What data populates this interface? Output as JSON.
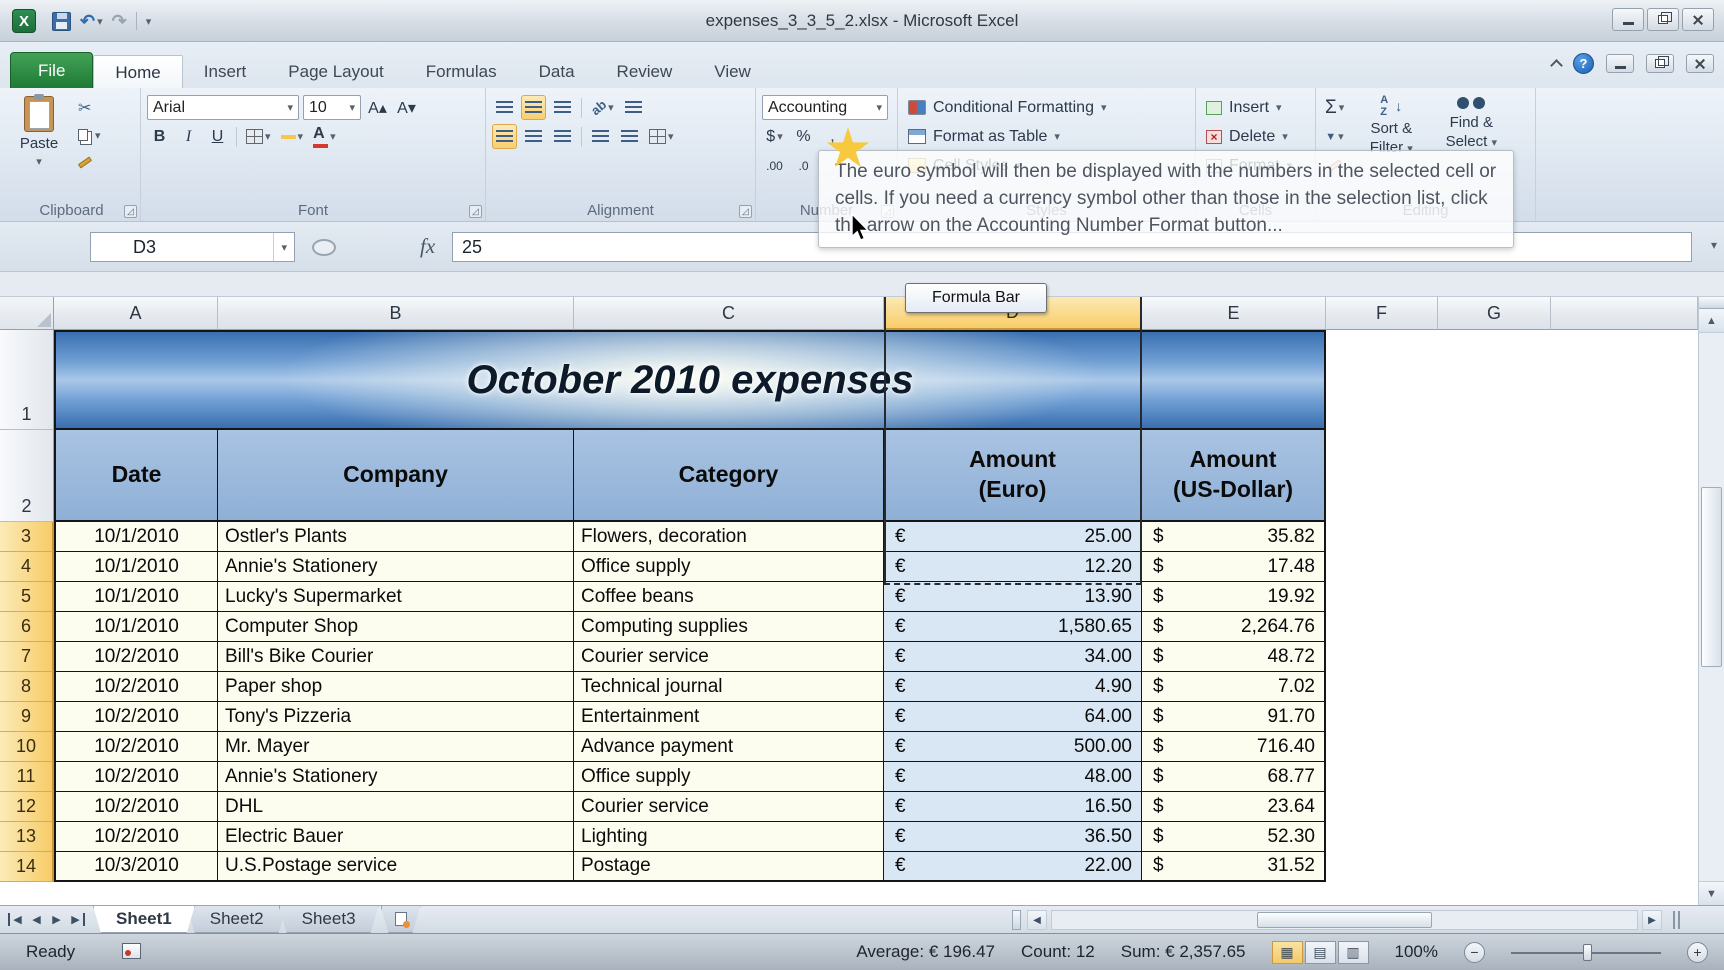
{
  "title_bar": {
    "title": "expenses_3_3_5_2.xlsx - Microsoft Excel"
  },
  "icons": {
    "dropdown": "▾",
    "undo": "↶",
    "redo": "↷",
    "scissors": "✂",
    "sigma": "Σ",
    "dollar": "$",
    "percent": "%",
    "comma": ",",
    "bold": "B",
    "italic": "I",
    "underline": "U",
    "grow_font": "A▴",
    "shrink_font": "A▾",
    "font_color_letter": "A",
    "increase_decimal": ".00",
    "decrease_decimal": ".0",
    "help": "?",
    "up_arrow": "▲",
    "down_arrow": "▼",
    "left_arrow": "◀",
    "right_arrow": "▶",
    "sort_a": "A",
    "sort_z": "Z",
    "small_down": "↓",
    "dialog_launcher": "◿",
    "view_normal": "▦",
    "view_layout": "▤",
    "view_break": "▥",
    "minus": "−",
    "plus": "+",
    "chevron_down": "▾"
  },
  "ribbon": {
    "tabs": [
      "File",
      "Home",
      "Insert",
      "Page Layout",
      "Formulas",
      "Data",
      "Review",
      "View"
    ],
    "active_tab": "Home",
    "clipboard": {
      "paste": "Paste",
      "label": "Clipboard"
    },
    "font": {
      "name": "Arial",
      "size": "10",
      "label": "Font"
    },
    "alignment": {
      "label": "Alignment"
    },
    "number": {
      "format": "Accounting",
      "label": "Number"
    },
    "styles": {
      "conditional_formatting": "Conditional Formatting",
      "format_as_table": "Format as Table",
      "cell_styles": "Cell Styles",
      "label": "Styles"
    },
    "cells": {
      "insert": "Insert",
      "delete": "Delete",
      "format": "Format",
      "label": "Cells"
    },
    "editing": {
      "sort_line1": "Sort &",
      "sort_line2": "Filter",
      "find_line1": "Find &",
      "find_line2": "Select",
      "label": "Editing"
    }
  },
  "tooltip": {
    "text": "The euro symbol will then be displayed with the numbers in the selected cell or cells. If you need a currency symbol other than those in the selection list, click the arrow on the Accounting Number Format button..."
  },
  "formula_bar": {
    "cell_ref": "D3",
    "fx": "fx",
    "value": "25",
    "tooltip": "Formula Bar"
  },
  "colors": {
    "table_header_fill": "#95b3d7",
    "selection_fill": "#d9e7f5",
    "selected_header_fill": "#f8cd69",
    "file_tab_green": "#1e7a35",
    "title_fill_blue": "#3f77b5"
  },
  "sheet": {
    "columns": [
      "A",
      "B",
      "C",
      "D",
      "E",
      "F",
      "G"
    ],
    "selected_column": "D",
    "title": "October 2010 expenses",
    "headers": [
      "Date",
      "Company",
      "Category",
      "Amount\n(Euro)",
      "Amount\n(US-Dollar)"
    ],
    "currency": {
      "eur": "€",
      "usd": "$"
    },
    "rows": [
      {
        "n": 3,
        "date": "10/1/2010",
        "company": "Ostler's Plants",
        "category": "Flowers, decoration",
        "eur": "25.00",
        "usd": "35.82"
      },
      {
        "n": 4,
        "date": "10/1/2010",
        "company": "Annie's Stationery",
        "category": "Office supply",
        "eur": "12.20",
        "usd": "17.48"
      },
      {
        "n": 5,
        "date": "10/1/2010",
        "company": "Lucky's Supermarket",
        "category": "Coffee beans",
        "eur": "13.90",
        "usd": "19.92"
      },
      {
        "n": 6,
        "date": "10/1/2010",
        "company": "Computer Shop",
        "category": "Computing supplies",
        "eur": "1,580.65",
        "usd": "2,264.76"
      },
      {
        "n": 7,
        "date": "10/2/2010",
        "company": "Bill's Bike Courier",
        "category": "Courier service",
        "eur": "34.00",
        "usd": "48.72"
      },
      {
        "n": 8,
        "date": "10/2/2010",
        "company": "Paper shop",
        "category": "Technical journal",
        "eur": "4.90",
        "usd": "7.02"
      },
      {
        "n": 9,
        "date": "10/2/2010",
        "company": "Tony's Pizzeria",
        "category": "Entertainment",
        "eur": "64.00",
        "usd": "91.70"
      },
      {
        "n": 10,
        "date": "10/2/2010",
        "company": "Mr. Mayer",
        "category": "Advance payment",
        "eur": "500.00",
        "usd": "716.40"
      },
      {
        "n": 11,
        "date": "10/2/2010",
        "company": "Annie's Stationery",
        "category": "Office supply",
        "eur": "48.00",
        "usd": "68.77"
      },
      {
        "n": 12,
        "date": "10/2/2010",
        "company": "DHL",
        "category": "Courier service",
        "eur": "16.50",
        "usd": "23.64"
      },
      {
        "n": 13,
        "date": "10/2/2010",
        "company": "Electric Bauer",
        "category": "Lighting",
        "eur": "36.50",
        "usd": "52.30"
      },
      {
        "n": 14,
        "date": "10/3/2010",
        "company": "U.S.Postage service",
        "category": "Postage",
        "eur": "22.00",
        "usd": "31.52"
      }
    ]
  },
  "sheet_tabs": {
    "tabs": [
      "Sheet1",
      "Sheet2",
      "Sheet3"
    ],
    "active": "Sheet1"
  },
  "status_bar": {
    "ready": "Ready",
    "average": "Average: € 196.47",
    "count": "Count: 12",
    "sum": "Sum: € 2,357.65",
    "zoom": "100%"
  }
}
